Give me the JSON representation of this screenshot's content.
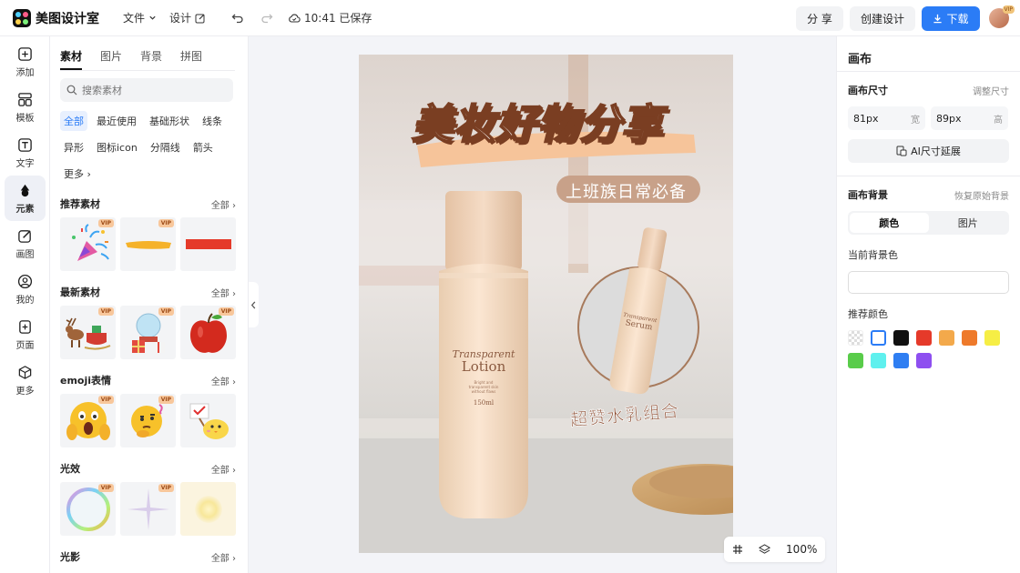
{
  "app": {
    "name": "美图设计室"
  },
  "header": {
    "menu_file": "文件",
    "menu_design": "设计",
    "save_status": "10:41 已保存",
    "share": "分 享",
    "create_design": "创建设计",
    "download": "下载",
    "avatar_badge": "VIP"
  },
  "nav": [
    {
      "label": "添加",
      "icon": "plus-square-icon"
    },
    {
      "label": "模板",
      "icon": "template-icon"
    },
    {
      "label": "文字",
      "icon": "text-icon"
    },
    {
      "label": "元素",
      "icon": "shapes-icon"
    },
    {
      "label": "画图",
      "icon": "draw-icon"
    },
    {
      "label": "我的",
      "icon": "user-icon"
    },
    {
      "label": "页面",
      "icon": "page-icon"
    },
    {
      "label": "更多",
      "icon": "cube-icon"
    }
  ],
  "panel": {
    "tabs": [
      "素材",
      "图片",
      "背景",
      "拼图"
    ],
    "search_placeholder": "搜索素材",
    "chips": [
      "全部",
      "最近使用",
      "基础形状",
      "线条",
      "异形",
      "图标icon",
      "分隔线",
      "箭头",
      "更多"
    ],
    "all_label": "全部",
    "vip": "VIP",
    "sections": [
      {
        "title": "推荐素材",
        "items": [
          "party-popper",
          "orange-brush-stroke",
          "red-rectangle"
        ]
      },
      {
        "title": "最新素材",
        "items": [
          "reindeer-sleigh",
          "snow-globe-gifts",
          "red-apple"
        ]
      },
      {
        "title": "emoji表情",
        "items": [
          "screaming-emoji",
          "thinking-emoji",
          "chick-with-sign"
        ]
      },
      {
        "title": "光效",
        "items": [
          "rainbow-bubble",
          "sparkle-star",
          "soft-glow"
        ]
      },
      {
        "title": "光影",
        "items": []
      }
    ]
  },
  "poster": {
    "headline": "美妆好物分享",
    "tag_text": "上班族日常必备",
    "caption": "超赞水乳组合",
    "bottle_brand": "Transparent",
    "bottle_product": "Lotion",
    "bottle_small1": "Bright and",
    "bottle_small2": "transparent skin",
    "bottle_small3": "without flaws",
    "bottle_volume": "150ml",
    "serum_brand": "Transparent",
    "serum_product": "Serum"
  },
  "zoom": {
    "level": "100%"
  },
  "right_panel": {
    "title": "画布",
    "size_label": "画布尺寸",
    "resize_link": "调整尺寸",
    "width_value": "81px",
    "width_unit": "宽",
    "height_value": "89px",
    "height_unit": "高",
    "ai_extend": "AI尺寸延展",
    "bg_label": "画布背景",
    "reset_bg": "恢复原始背景",
    "seg_color": "颜色",
    "seg_image": "图片",
    "current_bg_label": "当前背景色",
    "recommended_label": "推荐颜色",
    "swatches": [
      "transparent",
      "#ffffff",
      "#111111",
      "#e53a2a",
      "#f3a94b",
      "#ee7a2b",
      "#f6ee45",
      "#59cc4a",
      "#5ff0ee",
      "#2f7ef2",
      "#8e4ff0"
    ]
  }
}
